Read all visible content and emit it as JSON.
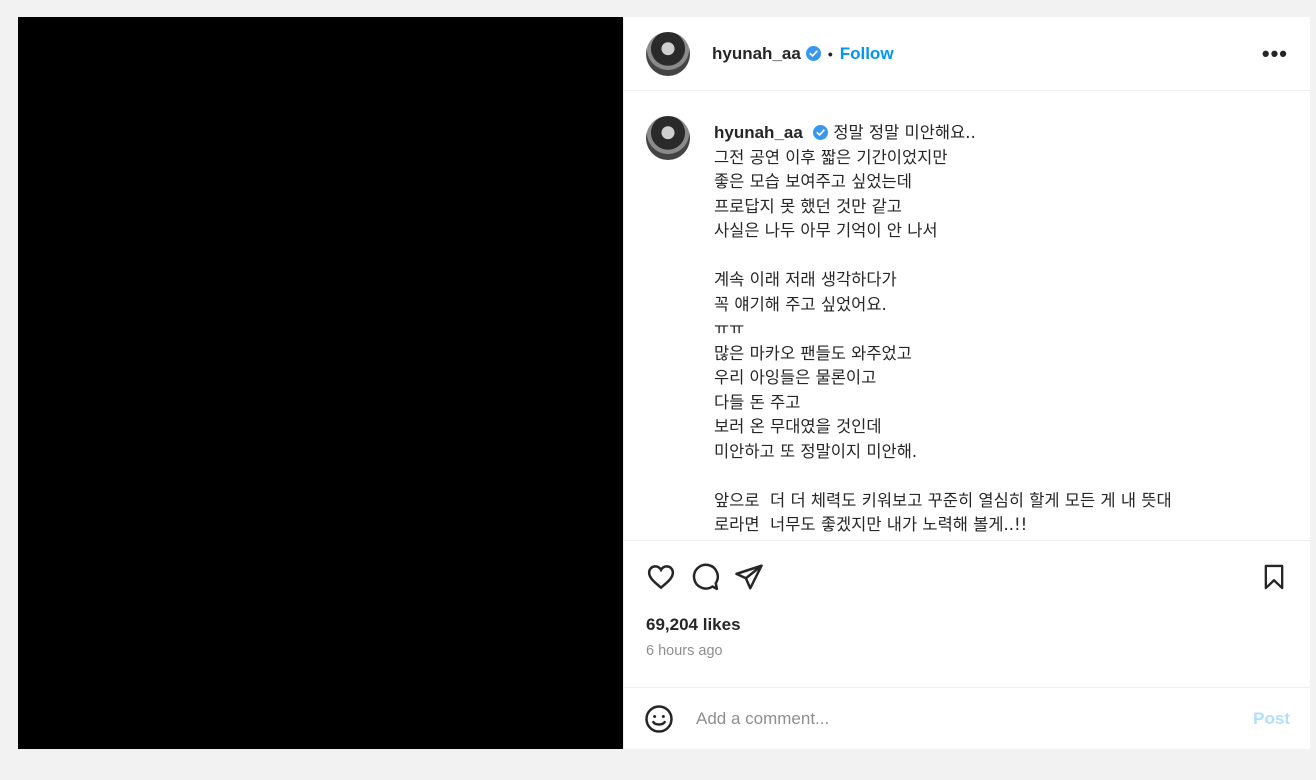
{
  "header": {
    "username": "hyunah_aa",
    "separator": "•",
    "follow_label": "Follow",
    "more_label": "•••"
  },
  "caption": {
    "username": "hyunah_aa",
    "text": "정말 정말 미안해요..\n그전 공연 이후 짧은 기간이었지만\n좋은 모습 보여주고 싶었는데\n프로답지 못 했던 것만 같고\n사실은 나두 아무 기억이 안 나서\n\n계속 이래 저래 생각하다가\n꼭 얘기해 주고 싶었어요.\nㅠㅠ\n많은 마카오 팬들도 와주었고\n우리 아잉들은 물론이고\n다들 돈 주고\n보러 온 무대였을 것인데\n미안하고 또 정말이지 미안해.\n\n앞으로  더 더 체력도 키워보고 꾸준히 열심히 할게 모든 게 내 뜻대\n로라면  너무도 좋겠지만 내가 노력해 볼게..!!"
  },
  "stats": {
    "likes": "69,204 likes",
    "time": "6 hours ago"
  },
  "comment": {
    "placeholder": "Add a comment...",
    "post_label": "Post"
  },
  "colors": {
    "accent": "#0095f6",
    "post_disabled": "#b2dffc",
    "verified": "#3897f0"
  },
  "icons": [
    "heart-icon",
    "comment-icon",
    "share-icon",
    "bookmark-icon",
    "emoji-icon",
    "verified-icon",
    "more-icon"
  ]
}
